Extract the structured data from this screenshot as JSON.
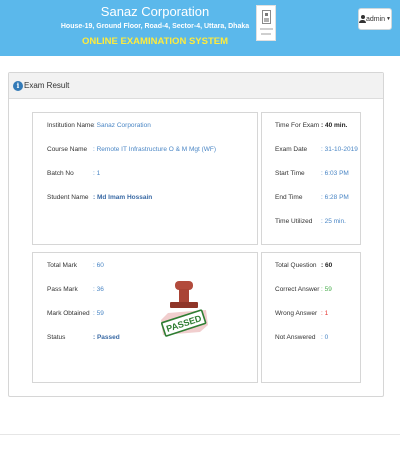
{
  "header": {
    "org_name": "Sanaz Corporation",
    "address": "House-19, Ground Floor, Road-4, Sector-4, Uttara, Dhaka",
    "system_title": "ONLINE EXAMINATION SYSTEM",
    "user_menu": "admin",
    "colors": {
      "bar": "#5bb8eb",
      "title": "#ffeb3b"
    }
  },
  "panel": {
    "title": "Exam Result"
  },
  "exam_info": {
    "institution_label": "Institution Name",
    "institution_value": ": Sanaz Corporation",
    "course_label": "Course Name",
    "course_value": ": Remote IT Infrastructure O & M Mgt (WF)",
    "batch_label": "Batch No",
    "batch_value": ": 1",
    "student_label": "Student Name",
    "student_value": ": Md Imam Hossain"
  },
  "exam_time": {
    "time_for_exam_label": "Time For Exam",
    "time_for_exam_value": ": 40 min.",
    "exam_date_label": "Exam Date",
    "exam_date_value": ": 31-10-2019",
    "start_time_label": "Start Time",
    "start_time_value": ": 6:03 PM",
    "end_time_label": "End Time",
    "end_time_value": ": 6:28 PM",
    "time_utilized_label": "Time Utilized",
    "time_utilized_value": ": 25 min."
  },
  "marks": {
    "total_mark_label": "Total Mark",
    "total_mark_value": ": 60",
    "pass_mark_label": "Pass Mark",
    "pass_mark_value": ": 36",
    "mark_obtained_label": "Mark Obtained",
    "mark_obtained_value": ": 59",
    "status_label": "Status",
    "status_value": ": Passed",
    "stamp_text": "PASSED"
  },
  "answers": {
    "total_question_label": "Total Question",
    "total_question_value": ": 60",
    "correct_label": "Correct Answer",
    "correct_value": ": 59",
    "wrong_label": "Wrong Answer",
    "wrong_value": ": 1",
    "not_answered_label": "Not Answered",
    "not_answered_value": ": 0"
  },
  "icons": {
    "logo": "organization-logo",
    "user": "user-icon",
    "caret": "caret-down-icon",
    "info": "info-icon",
    "stamp": "passed-stamp-icon"
  }
}
